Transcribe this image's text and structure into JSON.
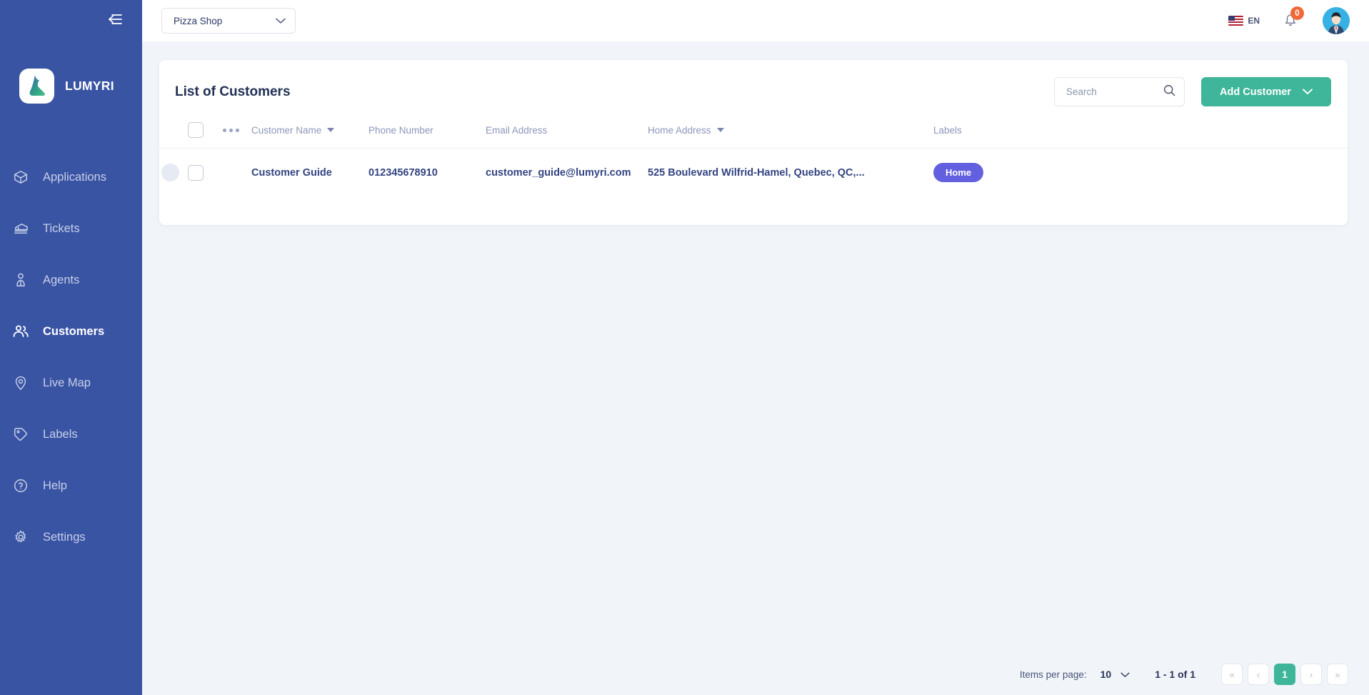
{
  "sidebar": {
    "brand_name": "LUMYRI",
    "collapse_icon": "collapse-menu-icon",
    "items": [
      {
        "label": "Applications",
        "icon": "box-icon",
        "active": false
      },
      {
        "label": "Tickets",
        "icon": "ticket-icon",
        "active": false
      },
      {
        "label": "Agents",
        "icon": "agent-icon",
        "active": false
      },
      {
        "label": "Customers",
        "icon": "users-icon",
        "active": true
      },
      {
        "label": "Live Map",
        "icon": "map-pin-icon",
        "active": false
      },
      {
        "label": "Labels",
        "icon": "tag-icon",
        "active": false
      },
      {
        "label": "Help",
        "icon": "question-circle-icon",
        "active": false
      },
      {
        "label": "Settings",
        "icon": "gear-icon",
        "active": false
      }
    ]
  },
  "topbar": {
    "shop_selected": "Pizza Shop",
    "language": "EN",
    "language_flag": "us-flag-icon",
    "notification_count": "0",
    "notification_icon": "bell-icon",
    "avatar_icon": "user-avatar"
  },
  "card": {
    "title": "List of Customers",
    "search": {
      "value": "",
      "placeholder": "Search",
      "icon": "search-icon"
    },
    "add_button": {
      "label": "Add Customer",
      "icon": "chevron-down-icon"
    }
  },
  "table": {
    "columns": [
      {
        "key": "expand",
        "label": "",
        "sortable": false
      },
      {
        "key": "check",
        "label": "",
        "sortable": false
      },
      {
        "key": "dots",
        "label": "",
        "sortable": false
      },
      {
        "key": "name",
        "label": "Customer Name",
        "sortable": true
      },
      {
        "key": "phone",
        "label": "Phone Number",
        "sortable": false
      },
      {
        "key": "email",
        "label": "Email Address",
        "sortable": false
      },
      {
        "key": "address",
        "label": "Home Address",
        "sortable": true
      },
      {
        "key": "labels",
        "label": "Labels",
        "sortable": false
      }
    ],
    "rows": [
      {
        "name": "Customer Guide",
        "phone": "012345678910",
        "email": "customer_guide@lumyri.com",
        "address": "525 Boulevard Wilfrid-Hamel, Quebec, QC,...",
        "labels": [
          "Home"
        ]
      }
    ]
  },
  "pagination": {
    "items_per_page_label": "Items per page:",
    "items_per_page_value": "10",
    "range": "1 - 1 of 1",
    "first_label": "«",
    "prev_label": "‹",
    "current_page": "1",
    "next_label": "›",
    "last_label": "»"
  },
  "colors": {
    "sidebar_bg": "#3a54a4",
    "accent_green": "#3fb699",
    "chip_purple": "#6360df",
    "badge_orange": "#f0693a",
    "page_bg": "#f1f4f9",
    "text_dark": "#223055",
    "header_text": "#8d97bb"
  }
}
